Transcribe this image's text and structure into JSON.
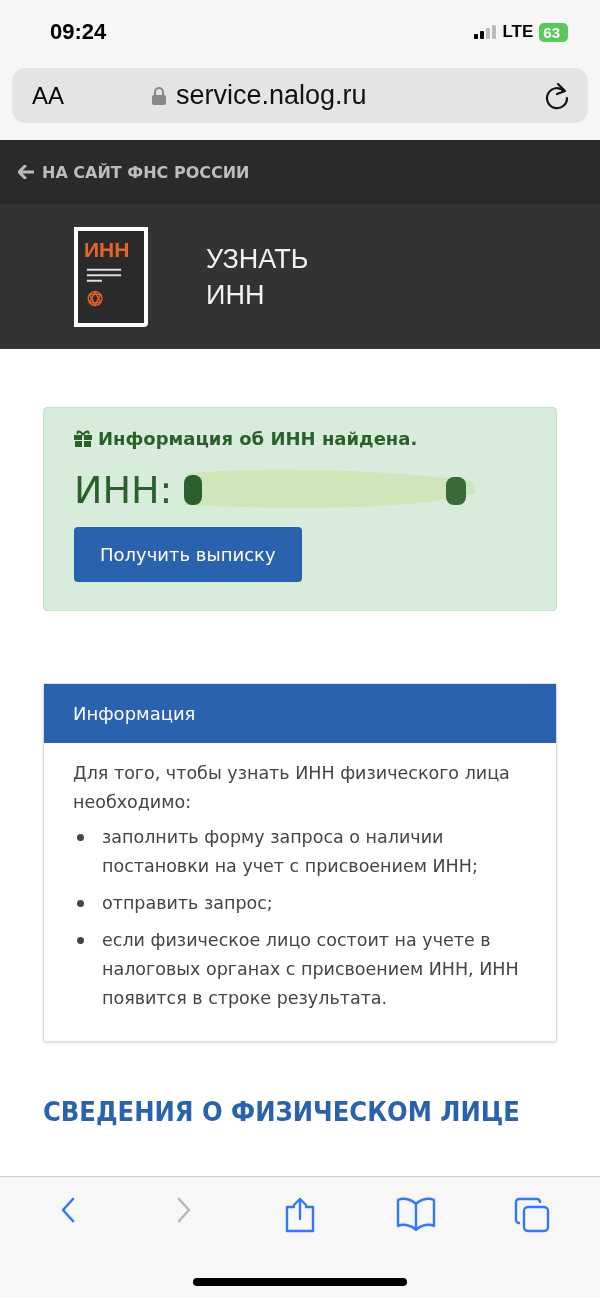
{
  "status_bar": {
    "time": "09:24",
    "network": "LTE",
    "battery": "63"
  },
  "address_bar": {
    "text_size": "AA",
    "url": "service.nalog.ru"
  },
  "top_link": {
    "label": "НА САЙТ ФНС РОССИИ"
  },
  "header": {
    "logo_text": "ИНН",
    "title_lines": [
      "УЗНАТЬ",
      "ИНН"
    ]
  },
  "result": {
    "message": "Информация об ИНН найдена.",
    "inn_label": "ИНН:",
    "button": "Получить выписку"
  },
  "info_card": {
    "title": "Информация",
    "intro": "Для того, чтобы узнать ИНН физического лица необходимо:",
    "items": [
      "заполнить форму запроса о наличии постановки на учет с присвоением ИНН;",
      "отправить запрос;",
      "если физическое лицо состоит на учете в налоговых органах с присвоением ИНН, ИНН появится в строке результата."
    ]
  },
  "section_heading": "СВЕДЕНИЯ О ФИЗИЧЕСКОМ ЛИЦЕ",
  "toolbar": [
    {
      "kind": "back",
      "disabled": false
    },
    {
      "kind": "forward",
      "disabled": true
    },
    {
      "kind": "share",
      "disabled": false
    },
    {
      "kind": "bookmarks",
      "disabled": false
    },
    {
      "kind": "tabs",
      "disabled": false
    }
  ]
}
